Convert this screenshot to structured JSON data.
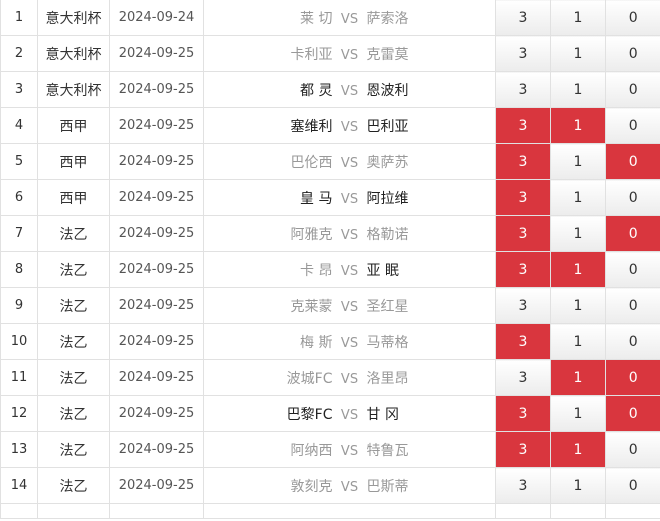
{
  "rows": [
    {
      "num": "1",
      "league": "意大利杯",
      "date": "2024-09-24",
      "home": "莱 切",
      "away": "萨索洛",
      "bold": "none",
      "odds": [
        "3",
        "1",
        "0"
      ],
      "hits": [
        false,
        false,
        false
      ]
    },
    {
      "num": "2",
      "league": "意大利杯",
      "date": "2024-09-25",
      "home": "卡利亚",
      "away": "克雷莫",
      "bold": "none",
      "odds": [
        "3",
        "1",
        "0"
      ],
      "hits": [
        false,
        false,
        false
      ]
    },
    {
      "num": "3",
      "league": "意大利杯",
      "date": "2024-09-25",
      "home": "都 灵",
      "away": "恩波利",
      "bold": "both",
      "odds": [
        "3",
        "1",
        "0"
      ],
      "hits": [
        false,
        false,
        false
      ]
    },
    {
      "num": "4",
      "league": "西甲",
      "date": "2024-09-25",
      "home": "塞维利",
      "away": "巴利亚",
      "bold": "both",
      "odds": [
        "3",
        "1",
        "0"
      ],
      "hits": [
        true,
        true,
        false
      ]
    },
    {
      "num": "5",
      "league": "西甲",
      "date": "2024-09-25",
      "home": "巴伦西",
      "away": "奥萨苏",
      "bold": "none",
      "odds": [
        "3",
        "1",
        "0"
      ],
      "hits": [
        true,
        false,
        true
      ]
    },
    {
      "num": "6",
      "league": "西甲",
      "date": "2024-09-25",
      "home": "皇 马",
      "away": "阿拉维",
      "bold": "both",
      "odds": [
        "3",
        "1",
        "0"
      ],
      "hits": [
        true,
        false,
        false
      ]
    },
    {
      "num": "7",
      "league": "法乙",
      "date": "2024-09-25",
      "home": "阿雅克",
      "away": "格勒诺",
      "bold": "none",
      "odds": [
        "3",
        "1",
        "0"
      ],
      "hits": [
        true,
        false,
        true
      ]
    },
    {
      "num": "8",
      "league": "法乙",
      "date": "2024-09-25",
      "home": "卡 昂",
      "away": "亚 眠",
      "bold": "away",
      "odds": [
        "3",
        "1",
        "0"
      ],
      "hits": [
        true,
        true,
        false
      ]
    },
    {
      "num": "9",
      "league": "法乙",
      "date": "2024-09-25",
      "home": "克莱蒙",
      "away": "圣红星",
      "bold": "none",
      "odds": [
        "3",
        "1",
        "0"
      ],
      "hits": [
        false,
        false,
        false
      ]
    },
    {
      "num": "10",
      "league": "法乙",
      "date": "2024-09-25",
      "home": "梅 斯",
      "away": "马蒂格",
      "bold": "none",
      "odds": [
        "3",
        "1",
        "0"
      ],
      "hits": [
        true,
        false,
        false
      ]
    },
    {
      "num": "11",
      "league": "法乙",
      "date": "2024-09-25",
      "home": "波城FC",
      "away": "洛里昂",
      "bold": "none",
      "odds": [
        "3",
        "1",
        "0"
      ],
      "hits": [
        false,
        true,
        true
      ]
    },
    {
      "num": "12",
      "league": "法乙",
      "date": "2024-09-25",
      "home": "巴黎FC",
      "away": "甘 冈",
      "bold": "both",
      "odds": [
        "3",
        "1",
        "0"
      ],
      "hits": [
        true,
        false,
        true
      ]
    },
    {
      "num": "13",
      "league": "法乙",
      "date": "2024-09-25",
      "home": "阿纳西",
      "away": "特鲁瓦",
      "bold": "none",
      "odds": [
        "3",
        "1",
        "0"
      ],
      "hits": [
        true,
        true,
        false
      ]
    },
    {
      "num": "14",
      "league": "法乙",
      "date": "2024-09-25",
      "home": "敦刻克",
      "away": "巴斯蒂",
      "bold": "none",
      "odds": [
        "3",
        "1",
        "0"
      ],
      "hits": [
        false,
        false,
        false
      ]
    }
  ],
  "vs_label": "VS",
  "colors": {
    "hit": "#d9363e",
    "border": "#e1e1e1",
    "dim_text": "#999999"
  }
}
